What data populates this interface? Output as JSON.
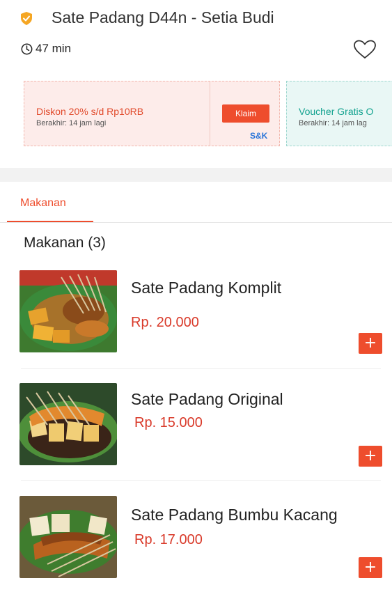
{
  "store": {
    "name": "Sate Padang D44n - Setia Budi",
    "delivery_time": "47 min",
    "badge_icon": "shield-badge-icon",
    "favorite_icon": "heart-outline-icon"
  },
  "vouchers": [
    {
      "title": "Diskon 20% s/d Rp10RB",
      "expiry": "Berakhir: 14 jam lagi",
      "claim_label": "Klaim",
      "terms_label": "S&K"
    },
    {
      "title": "Voucher Gratis O",
      "expiry": "Berakhir: 14 jam lag"
    }
  ],
  "tabs": [
    {
      "label": "Makanan",
      "active": true
    }
  ],
  "section": {
    "title": "Makanan (3)"
  },
  "menu": [
    {
      "name": "Sate Padang Komplit",
      "price": "Rp. 20.000",
      "add_label": "+"
    },
    {
      "name": "Sate Padang Original",
      "price": "Rp. 15.000",
      "add_label": "+"
    },
    {
      "name": "Sate Padang Bumbu Kacang",
      "price": "Rp. 17.000",
      "add_label": "+"
    }
  ],
  "colors": {
    "accent": "#ee4d2d",
    "price": "#d93a2a",
    "badge": "#f5a623",
    "voucher_discount_bg": "#fdecea",
    "voucher_free_bg": "#e9f7f5",
    "voucher_free_text": "#12a28f",
    "link": "#2a74d8"
  }
}
